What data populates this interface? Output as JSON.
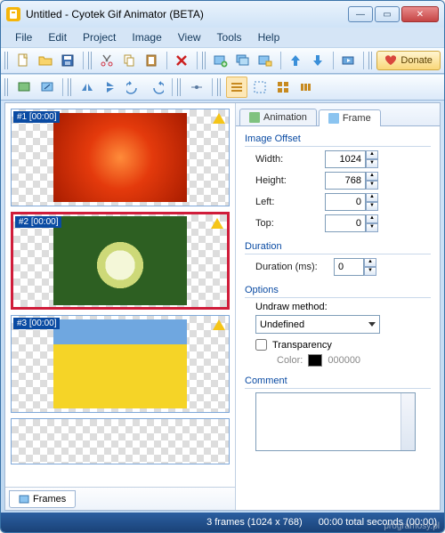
{
  "window": {
    "title": "Untitled - Cyotek Gif Animator (BETA)"
  },
  "menu": [
    "File",
    "Edit",
    "Project",
    "Image",
    "View",
    "Tools",
    "Help"
  ],
  "toolbar": {
    "donate": "Donate"
  },
  "frames": {
    "tab_label": "Frames",
    "items": [
      {
        "label": "#1 [00:00]",
        "selected": false
      },
      {
        "label": "#2 [00:00]",
        "selected": true
      },
      {
        "label": "#3 [00:00]",
        "selected": false
      }
    ]
  },
  "tabs": {
    "animation": "Animation",
    "frame": "Frame",
    "active": "frame"
  },
  "offset": {
    "title": "Image Offset",
    "width_label": "Width:",
    "width": "1024",
    "height_label": "Height:",
    "height": "768",
    "left_label": "Left:",
    "left": "0",
    "top_label": "Top:",
    "top": "0"
  },
  "duration": {
    "title": "Duration",
    "label": "Duration (ms):",
    "value": "0"
  },
  "options": {
    "title": "Options",
    "undraw_label": "Undraw method:",
    "undraw_value": "Undefined",
    "transparency_label": "Transparency",
    "color_label": "Color:",
    "color_value": "000000"
  },
  "comment": {
    "title": "Comment"
  },
  "status": {
    "frames": "3 frames (1024 x 768)",
    "time": "00:00 total seconds (00:00)"
  },
  "watermark": "programosy.pl"
}
